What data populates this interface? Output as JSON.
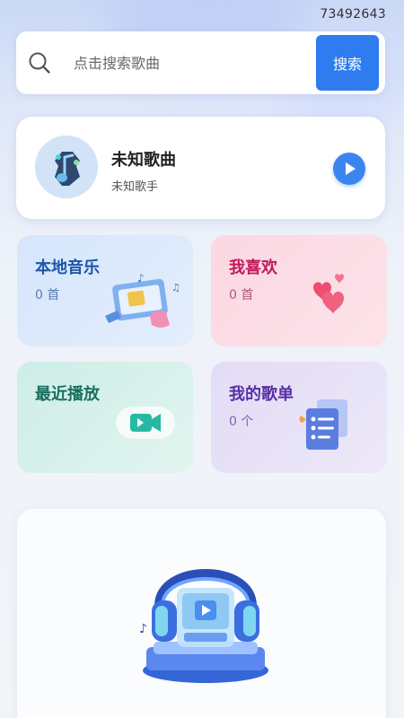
{
  "status": {
    "id_text": "73492643"
  },
  "search": {
    "placeholder": "点击搜索歌曲",
    "button_label": "搜索"
  },
  "now_playing": {
    "title": "未知歌曲",
    "artist": "未知歌手"
  },
  "tiles": [
    {
      "title": "本地音乐",
      "count": "0 首"
    },
    {
      "title": "我喜欢",
      "count": "0 首"
    },
    {
      "title": "最近播放"
    },
    {
      "title": "我的歌单",
      "count": "0 个"
    }
  ],
  "colors": {
    "accent": "#2f7cf0",
    "play": "#3b86ee",
    "local": "#1f56a8",
    "favorite": "#c2185b",
    "recent": "#19705f",
    "playlist": "#5a2ea6"
  },
  "icons": {
    "search": "search-icon",
    "play": "play-icon",
    "cover": "music-note-cover-icon",
    "local": "music-player-illustration-icon",
    "favorite": "hearts-illustration-icon",
    "recent": "video-play-illustration-icon",
    "playlist": "playlist-document-illustration-icon",
    "headphones": "headphones-illustration-icon"
  }
}
